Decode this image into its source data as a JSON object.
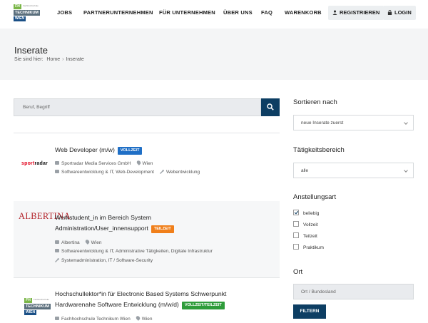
{
  "header": {
    "logo": {
      "fh": "FH",
      "tiny": "Fachhochschule",
      "tech": "TECHNIKUM",
      "wien": "WIEN"
    },
    "nav": [
      "JOBS",
      "PARTNERUNTERNEHMEN",
      "FÜR UNTERNEHMEN",
      "ÜBER UNS",
      "FAQ",
      "WARENKORB"
    ],
    "register_label": "REGISTRIEREN",
    "login_label": "LOGIN"
  },
  "page": {
    "title": "Inserate",
    "breadcrumb_prefix": "Sie sind hier:",
    "breadcrumb_home": "Home",
    "breadcrumb_current": "Inserate"
  },
  "search": {
    "placeholder": "Beruf, Begriff"
  },
  "listings": [
    {
      "logo_text_a": "sport",
      "logo_text_b": "radar",
      "title_line1": "Web Developer (m/w)",
      "title_line2": "",
      "badge": "VOLLZEIT",
      "company": "Sportradar Media Services GmbH",
      "location": "Wien",
      "categories": "Softwareentwicklung & IT, Web-Development",
      "skills": "Webentwicklung"
    },
    {
      "logo_text": "ALBERTINA",
      "title_line1": "Werkstudent_in im Bereich System",
      "title_line2": "Administration/User_innensupport",
      "badge": "TEILZEIT",
      "company": "Albertina",
      "location": "Wien",
      "categories": "Softwareentwicklung & IT, Administrative Tätigkeiten, Digitale Infrastruktur",
      "skills": "Systemadministration, IT / Software-Security"
    },
    {
      "title_line1": "Hochschullektor*in für Electronic Based Systems Schwerpunkt",
      "title_line2": "Hardwarenahe Software Entwicklung (m/w/d)",
      "badge": "VOLLZEIT/TEILZEIT",
      "company": "Fachhochschule Technikum Wien",
      "location": "Wien"
    }
  ],
  "sidebar": {
    "sort_heading": "Sortieren nach",
    "sort_value": "neue Inserate zuerst",
    "area_heading": "Tätigkeitsbereich",
    "area_value": "alle",
    "employment_heading": "Anstellungsart",
    "employment_options": [
      {
        "label": "beliebig",
        "checked": true
      },
      {
        "label": "Vollzeit",
        "checked": false
      },
      {
        "label": "Teilzeit",
        "checked": false
      },
      {
        "label": "Praktikum",
        "checked": false
      }
    ],
    "location_heading": "Ort",
    "location_placeholder": "Ort / Bundesland",
    "filter_label": "FILTERN"
  },
  "colors": {
    "primary": "#0d3e63",
    "badge_vollzeit": "#1f6fc6",
    "badge_teilzeit": "#f07f1a",
    "badge_vollzeit_teilzeit": "#2e9c3a",
    "fh_green": "#7ab648"
  }
}
